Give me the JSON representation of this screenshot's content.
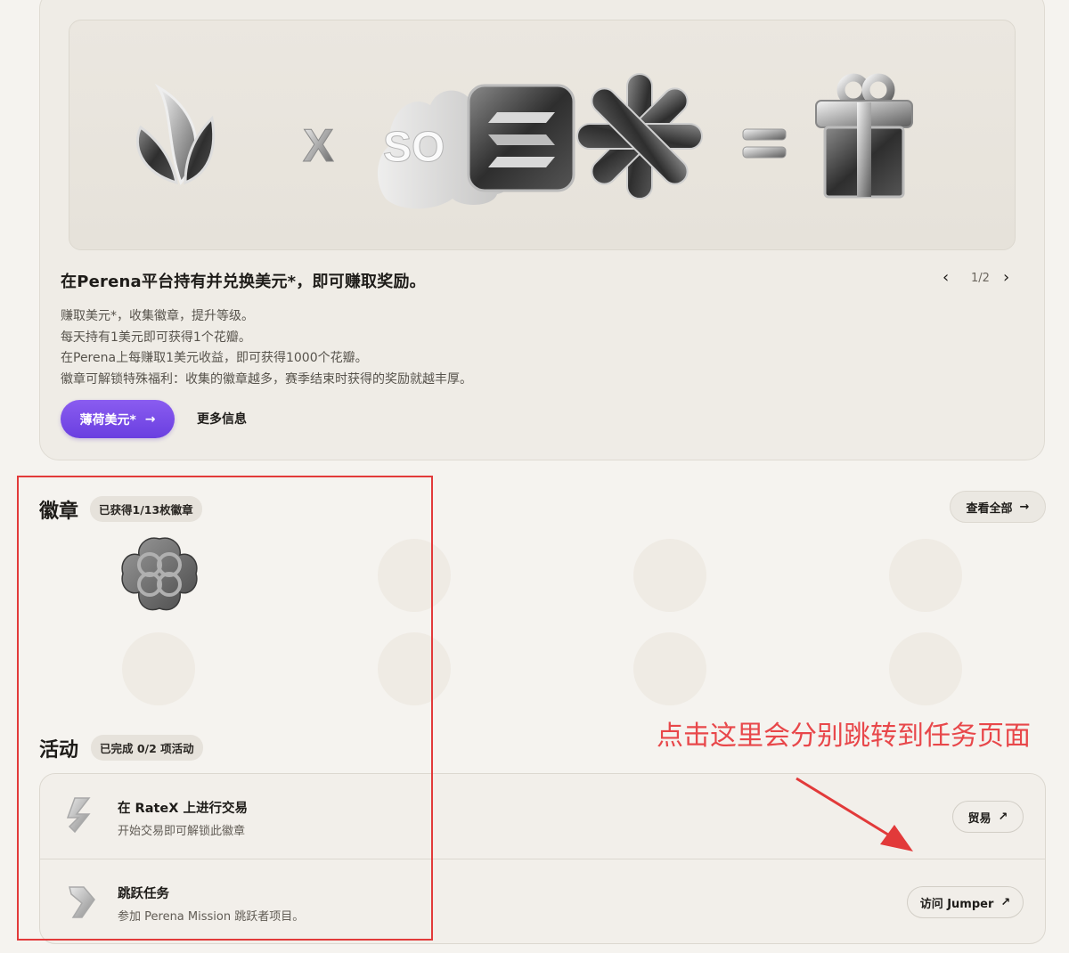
{
  "hero": {
    "image_label_x": "X",
    "image_label_so": "SO",
    "title": "在Perena平台持有并兑换美元*，即可赚取奖励。",
    "pager": {
      "prev_icon": "chevron-left-icon",
      "count": "1/2",
      "next_icon": "chevron-right-icon"
    },
    "description": [
      "赚取美元*，收集徽章，提升等级。",
      "每天持有1美元即可获得1个花瓣。",
      "在Perena上每赚取1美元收益，即可获得1000个花瓣。",
      "徽章可解锁特殊福利：收集的徽章越多，赛季结束时获得的奖励就越丰厚。"
    ],
    "primary_button": "薄荷美元*",
    "more_link": "更多信息"
  },
  "badges": {
    "title": "徽章",
    "earned_chip": "已获得1/13枚徽章",
    "view_all": "查看全部"
  },
  "activities": {
    "title": "活动",
    "completed_chip": "已完成 0/2 项活动",
    "items": [
      {
        "title": "在 RateX 上进行交易",
        "subtitle": "开始交易即可解锁此徽章",
        "button": "贸易",
        "icon": "ratex-icon"
      },
      {
        "title": "跳跃任务",
        "subtitle": "参加 Perena Mission 跳跃者项目。",
        "button": "访问 Jumper",
        "icon": "jumper-icon"
      }
    ]
  },
  "annotation": {
    "text": "点击这里会分别跳转到任务页面",
    "color": "#e8474a"
  },
  "colors": {
    "accent": "#7a4ee8",
    "annotation_red": "#e23a3a"
  }
}
